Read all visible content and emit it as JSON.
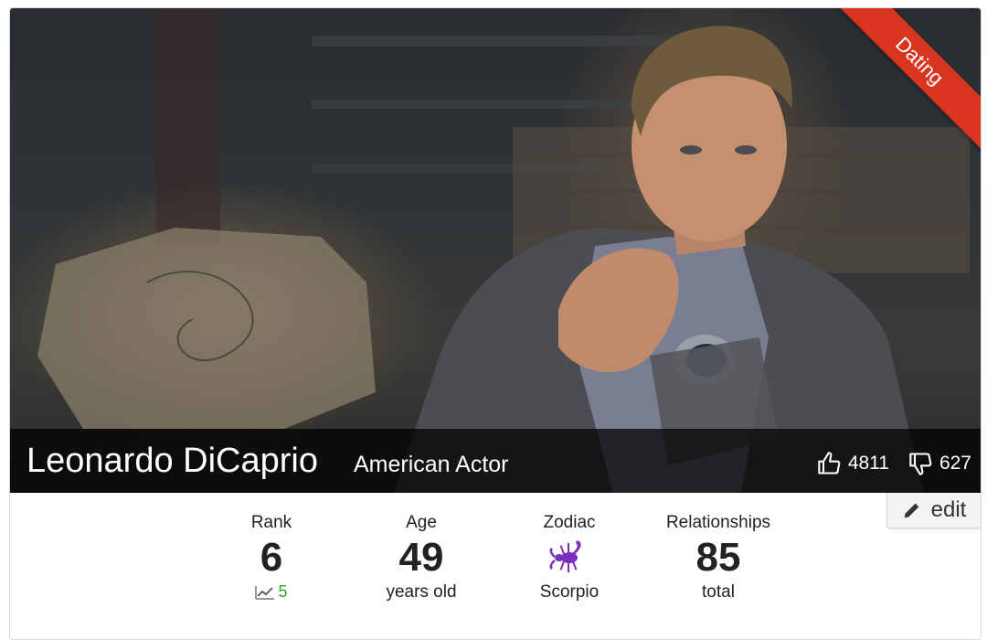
{
  "banner": {
    "label": "Dating",
    "color": "#d9341f"
  },
  "profile": {
    "name": "Leonardo DiCaprio",
    "occupation": "American Actor",
    "likes": "4811",
    "dislikes": "627",
    "like_icon": "thumbs-up-icon",
    "dislike_icon": "thumbs-down-icon"
  },
  "edit": {
    "label": "edit",
    "icon": "pencil-icon"
  },
  "stats": {
    "rank": {
      "label": "Rank",
      "value": "6",
      "trend": "5",
      "trend_icon": "trending-up-icon",
      "trend_color": "#2fa52f"
    },
    "age": {
      "label": "Age",
      "value": "49",
      "sub": "years old"
    },
    "zodiac": {
      "label": "Zodiac",
      "icon": "scorpio-icon",
      "sub": "Scorpio",
      "icon_color": "#7b2fbe"
    },
    "relationships": {
      "label": "Relationships",
      "value": "85",
      "sub": "total"
    }
  }
}
